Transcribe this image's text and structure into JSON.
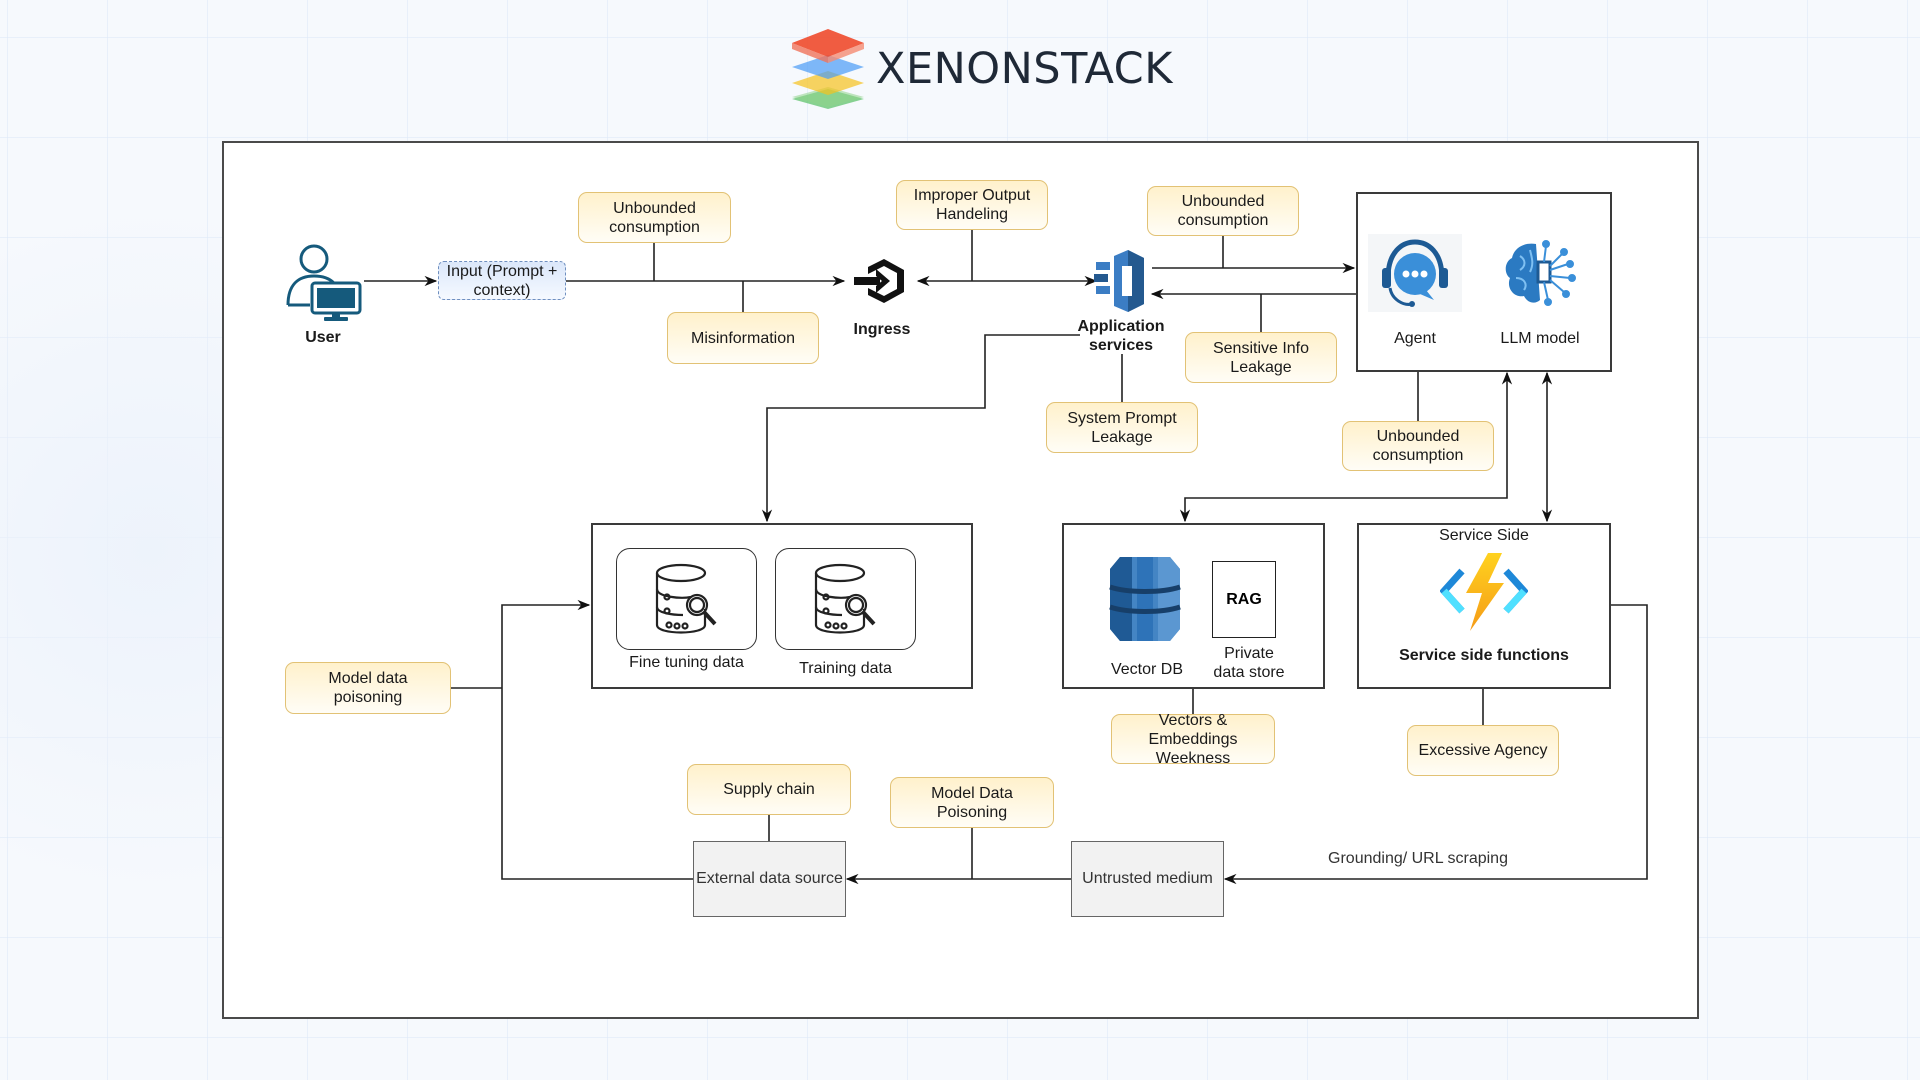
{
  "header": {
    "brand": "XENONSTACK",
    "logo_icon": "stacked-layers-logo",
    "logo_colors": [
      "#ef4a2c",
      "#4a9bf5",
      "#f6c21c",
      "#3cb54a"
    ]
  },
  "diagram": {
    "actors": {
      "user": {
        "label": "User",
        "icon": "user-computer-icon",
        "color": "#155a7c"
      },
      "ingress": {
        "label": "Ingress",
        "icon": "ingress-hexagon-arrow-icon"
      },
      "app_services": {
        "label_line1": "Application",
        "label_line2": "services",
        "icon": "app-services-icon",
        "color": "#3b7dc4"
      }
    },
    "input": {
      "line1": "Input (Prompt +",
      "line2": "context)"
    },
    "risks": {
      "unbounded_1": {
        "line1": "Unbounded",
        "line2": "consumption"
      },
      "misinformation": {
        "line1": "Misinformation"
      },
      "improper_output": {
        "line1": "Improper Output",
        "line2": "Handeling"
      },
      "unbounded_2": {
        "line1": "Unbounded",
        "line2": "consumption"
      },
      "sensitive_info": {
        "line1": "Sensitive Info",
        "line2": "Leakage"
      },
      "system_prompt": {
        "line1": "System Prompt",
        "line2": "Leakage"
      },
      "unbounded_3": {
        "line1": "Unbounded",
        "line2": "consumption"
      },
      "vectors_embeddings": {
        "line1": "Vectors & Embeddings",
        "line2": "Weekness"
      },
      "excessive_agency": {
        "line1": "Excessive Agency"
      },
      "model_data_poisoning_left": {
        "line1": "Model data poisoning"
      },
      "supply_chain": {
        "line1": "Supply chain"
      },
      "model_data_poisoning_bottom": {
        "line1": "Model Data Poisoning"
      }
    },
    "agent_llm_box": {
      "agent": {
        "label": "Agent",
        "icon": "headset-chat-icon"
      },
      "llm": {
        "label": "LLM model",
        "icon": "brain-circuit-icon"
      }
    },
    "data_box": {
      "fine_tuning": {
        "label": "Fine tuning data",
        "icon": "database-search-icon"
      },
      "training": {
        "label": "Training data",
        "icon": "database-search-icon"
      }
    },
    "vector_box": {
      "vector_db": {
        "label": "Vector DB",
        "icon": "dynamodb-cylinder-icon"
      },
      "rag": {
        "text": "RAG",
        "label_line1": "Private",
        "label_line2": "data store"
      }
    },
    "service_box": {
      "title": "Service Side",
      "icon": "azure-functions-lightning-icon",
      "label": "Service side functions"
    },
    "external_source": {
      "label": "External data source"
    },
    "untrusted_medium": {
      "label": "Untrusted medium"
    },
    "edge_labels": {
      "grounding": "Grounding/ URL scraping"
    }
  }
}
